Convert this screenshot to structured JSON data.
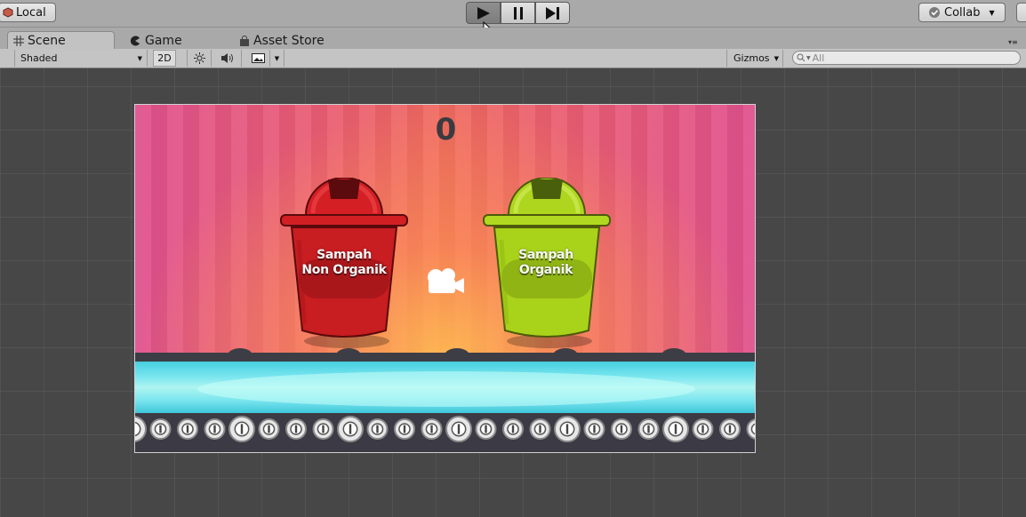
{
  "toolbar": {
    "layer_label": "Local",
    "collab_label": "Collab"
  },
  "tabs": [
    {
      "label": "Scene",
      "active": true
    },
    {
      "label": "Game",
      "active": false
    },
    {
      "label": "Asset Store",
      "active": false
    }
  ],
  "scene_bar": {
    "shading_mode": "Shaded",
    "mode_2d": "2D",
    "gizmos_label": "Gizmos",
    "search_placeholder": "All"
  },
  "game": {
    "score": "0",
    "bins": [
      {
        "line1": "Sampah",
        "line2": "Non Organik",
        "color": "#c81d21"
      },
      {
        "line1": "Sampah",
        "line2": "Organik",
        "color": "#a9d21b"
      }
    ]
  },
  "colors": {
    "editor_bg": "#474747",
    "toolbar_bg": "#a9a9a9",
    "water": "#7be6ef"
  }
}
